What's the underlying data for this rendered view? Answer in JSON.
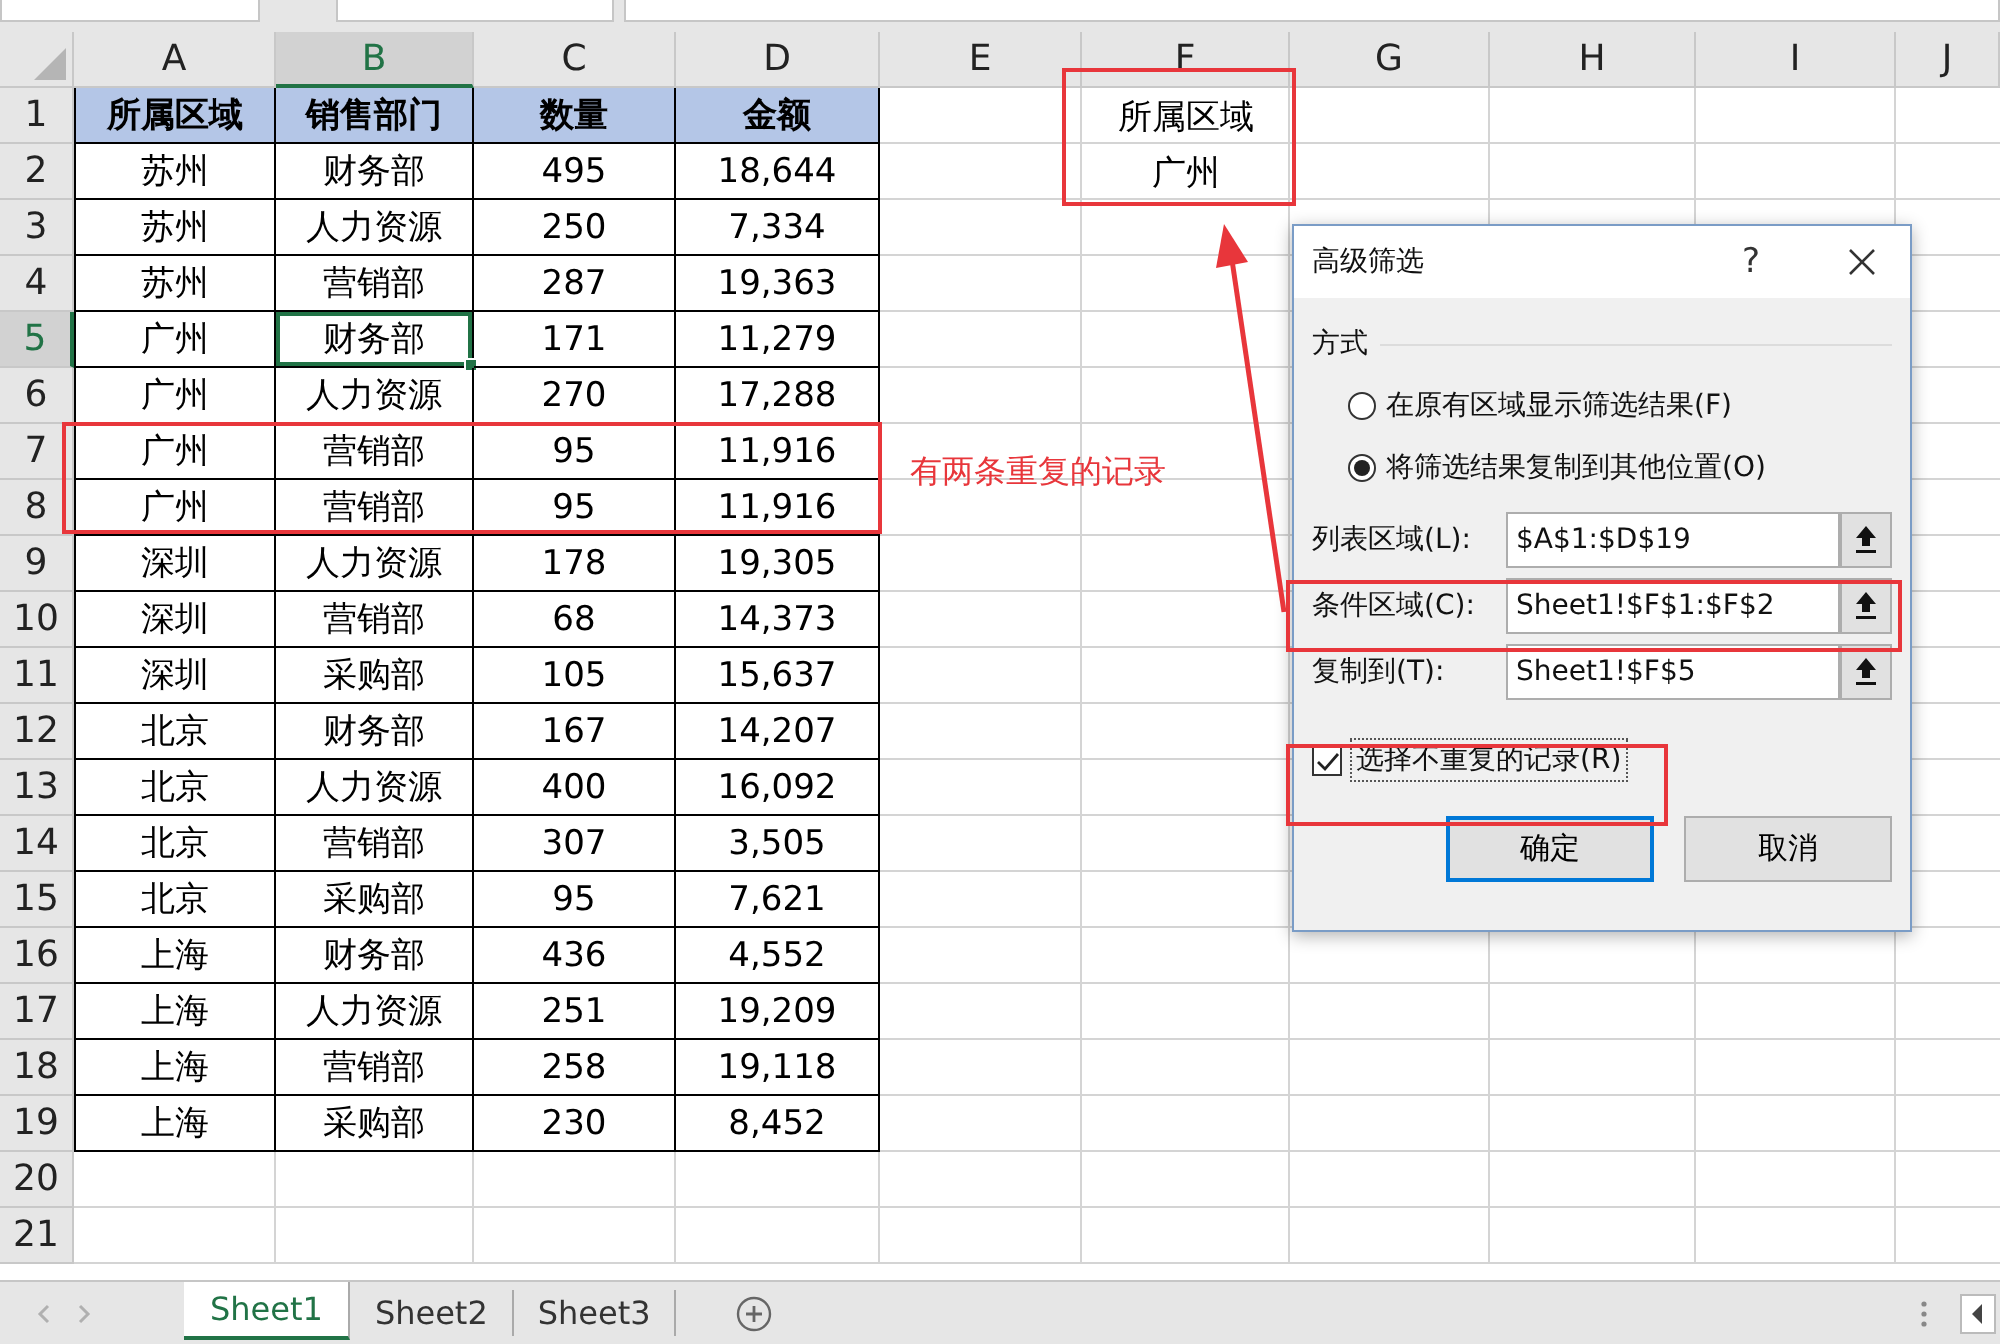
{
  "sheet": {
    "columns": [
      {
        "label": "A",
        "selected": false
      },
      {
        "label": "B",
        "selected": true
      },
      {
        "label": "C",
        "selected": false
      },
      {
        "label": "D",
        "selected": false
      },
      {
        "label": "E",
        "selected": false
      },
      {
        "label": "F",
        "selected": false
      },
      {
        "label": "G",
        "selected": false
      },
      {
        "label": "H",
        "selected": false
      },
      {
        "label": "I",
        "selected": false
      },
      {
        "label": "J",
        "selected": false
      }
    ],
    "rows": [
      {
        "number": "1",
        "selected": false,
        "kind": "header",
        "cells": [
          "所属区域",
          "销售部门",
          "数量",
          "金额"
        ]
      },
      {
        "number": "2",
        "selected": false,
        "kind": "data",
        "cells": [
          "苏州",
          "财务部",
          "495",
          "18,644"
        ]
      },
      {
        "number": "3",
        "selected": false,
        "kind": "data",
        "cells": [
          "苏州",
          "人力资源",
          "250",
          "7,334"
        ]
      },
      {
        "number": "4",
        "selected": false,
        "kind": "data",
        "cells": [
          "苏州",
          "营销部",
          "287",
          "19,363"
        ]
      },
      {
        "number": "5",
        "selected": true,
        "kind": "data",
        "cells": [
          "广州",
          "财务部",
          "171",
          "11,279"
        ]
      },
      {
        "number": "6",
        "selected": false,
        "kind": "data",
        "cells": [
          "广州",
          "人力资源",
          "270",
          "17,288"
        ]
      },
      {
        "number": "7",
        "selected": false,
        "kind": "data",
        "cells": [
          "广州",
          "营销部",
          "95",
          "11,916"
        ]
      },
      {
        "number": "8",
        "selected": false,
        "kind": "data",
        "cells": [
          "广州",
          "营销部",
          "95",
          "11,916"
        ]
      },
      {
        "number": "9",
        "selected": false,
        "kind": "data",
        "cells": [
          "深圳",
          "人力资源",
          "178",
          "19,305"
        ]
      },
      {
        "number": "10",
        "selected": false,
        "kind": "data",
        "cells": [
          "深圳",
          "营销部",
          "68",
          "14,373"
        ]
      },
      {
        "number": "11",
        "selected": false,
        "kind": "data",
        "cells": [
          "深圳",
          "采购部",
          "105",
          "15,637"
        ]
      },
      {
        "number": "12",
        "selected": false,
        "kind": "data",
        "cells": [
          "北京",
          "财务部",
          "167",
          "14,207"
        ]
      },
      {
        "number": "13",
        "selected": false,
        "kind": "data",
        "cells": [
          "北京",
          "人力资源",
          "400",
          "16,092"
        ]
      },
      {
        "number": "14",
        "selected": false,
        "kind": "data",
        "cells": [
          "北京",
          "营销部",
          "307",
          "3,505"
        ]
      },
      {
        "number": "15",
        "selected": false,
        "kind": "data",
        "cells": [
          "北京",
          "采购部",
          "95",
          "7,621"
        ]
      },
      {
        "number": "16",
        "selected": false,
        "kind": "data",
        "cells": [
          "上海",
          "财务部",
          "436",
          "4,552"
        ]
      },
      {
        "number": "17",
        "selected": false,
        "kind": "data",
        "cells": [
          "上海",
          "人力资源",
          "251",
          "19,209"
        ]
      },
      {
        "number": "18",
        "selected": false,
        "kind": "data",
        "cells": [
          "上海",
          "营销部",
          "258",
          "19,118"
        ]
      },
      {
        "number": "19",
        "selected": false,
        "kind": "data",
        "cells": [
          "上海",
          "采购部",
          "230",
          "8,452"
        ]
      },
      {
        "number": "20",
        "selected": false,
        "kind": "empty"
      },
      {
        "number": "21",
        "selected": false,
        "kind": "empty"
      }
    ],
    "criteria": [
      "所属区域",
      "广州"
    ]
  },
  "annotation": {
    "note": "有两条重复的记录"
  },
  "dialog": {
    "title": "高级筛选",
    "help": "?",
    "section": "方式",
    "options": [
      {
        "label": "在原有区域显示筛选结果(F)",
        "selected": false
      },
      {
        "label": "将筛选结果复制到其他位置(O)",
        "selected": true
      }
    ],
    "fields": [
      {
        "label": "列表区域(L):",
        "value": "$A$1:$D$19"
      },
      {
        "label": "条件区域(C):",
        "value": "Sheet1!$F$1:$F$2"
      },
      {
        "label": "复制到(T):",
        "value": "Sheet1!$F$5"
      }
    ],
    "unique": {
      "label": "选择不重复的记录(R)",
      "checked": true
    },
    "buttons": [
      {
        "label": "确定",
        "default": true
      },
      {
        "label": "取消",
        "default": false
      }
    ]
  },
  "tabs": [
    {
      "label": "Sheet1",
      "selected": true
    },
    {
      "label": "Sheet2",
      "selected": false
    },
    {
      "label": "Sheet3",
      "selected": false
    }
  ]
}
